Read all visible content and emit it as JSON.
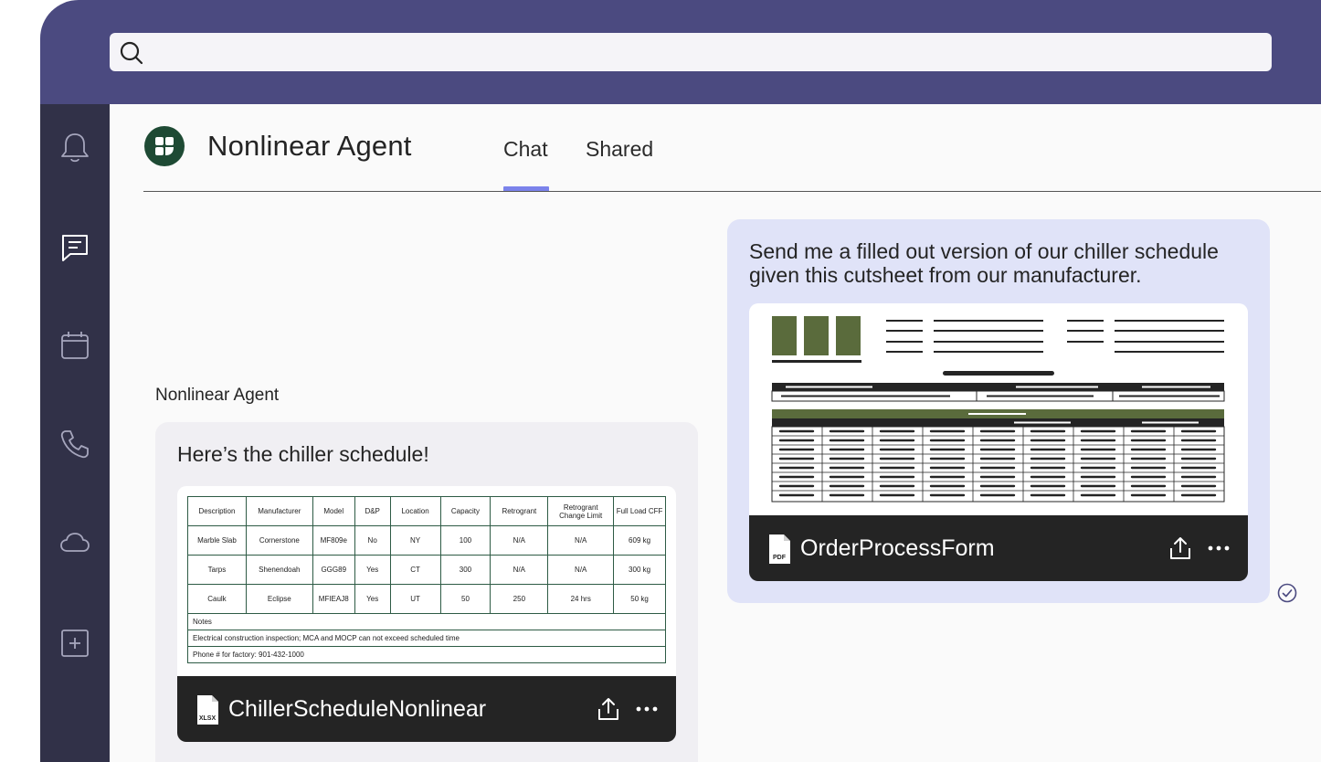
{
  "search": {
    "placeholder": "",
    "value": ""
  },
  "rail": {
    "items": [
      {
        "icon": "bell-icon",
        "name": "rail-activity"
      },
      {
        "icon": "chat-icon",
        "name": "rail-chat"
      },
      {
        "icon": "calendar-icon",
        "name": "rail-calendar"
      },
      {
        "icon": "phone-icon",
        "name": "rail-calls"
      },
      {
        "icon": "cloud-icon",
        "name": "rail-files"
      },
      {
        "icon": "plus-box-icon",
        "name": "rail-apps"
      }
    ]
  },
  "header": {
    "title": "Nonlinear Agent",
    "tabs": [
      {
        "label": "Chat",
        "active": true
      },
      {
        "label": "Shared",
        "active": false
      }
    ]
  },
  "messages": {
    "user": {
      "text": "Send me a filled out version of our chiller schedule given this cutsheet from our manufacturer.",
      "attachment": {
        "name": "OrderProcessForm",
        "type": "PDF"
      }
    },
    "agent": {
      "sender": "Nonlinear Agent",
      "text": "Here’s the chiller schedule!",
      "attachment": {
        "name": "ChillerScheduleNonlinear",
        "type": "XLSX"
      }
    }
  },
  "schedule": {
    "headers": [
      "Description",
      "Manufacturer",
      "Model",
      "D&P",
      "Location",
      "Capacity",
      "Retrogrant",
      "Retrogrant Change Limit",
      "Full Load CFF"
    ],
    "rows": [
      [
        "Marble Slab",
        "Cornerstone",
        "MF809e",
        "No",
        "NY",
        "100",
        "N/A",
        "N/A",
        "609 kg"
      ],
      [
        "Tarps",
        "Shenendoah",
        "GGG89",
        "Yes",
        "CT",
        "300",
        "N/A",
        "N/A",
        "300 kg"
      ],
      [
        "Caulk",
        "Eclipse",
        "MFIEAJ8",
        "Yes",
        "UT",
        "50",
        "250",
        "24 hrs",
        "50 kg"
      ]
    ],
    "notes": [
      "Notes",
      "Electrical construction inspection; MCA and MOCP can not exceed scheduled time",
      "Phone # for factory: 901-432-1000"
    ]
  },
  "colors": {
    "topbar": "#4b4a80",
    "rail": "#313148",
    "accent": "#7b83eb",
    "user_bubble": "#e0e3f8",
    "agent_bubble": "#f0eff3",
    "cutsheet_green": "#5a6b3c"
  }
}
